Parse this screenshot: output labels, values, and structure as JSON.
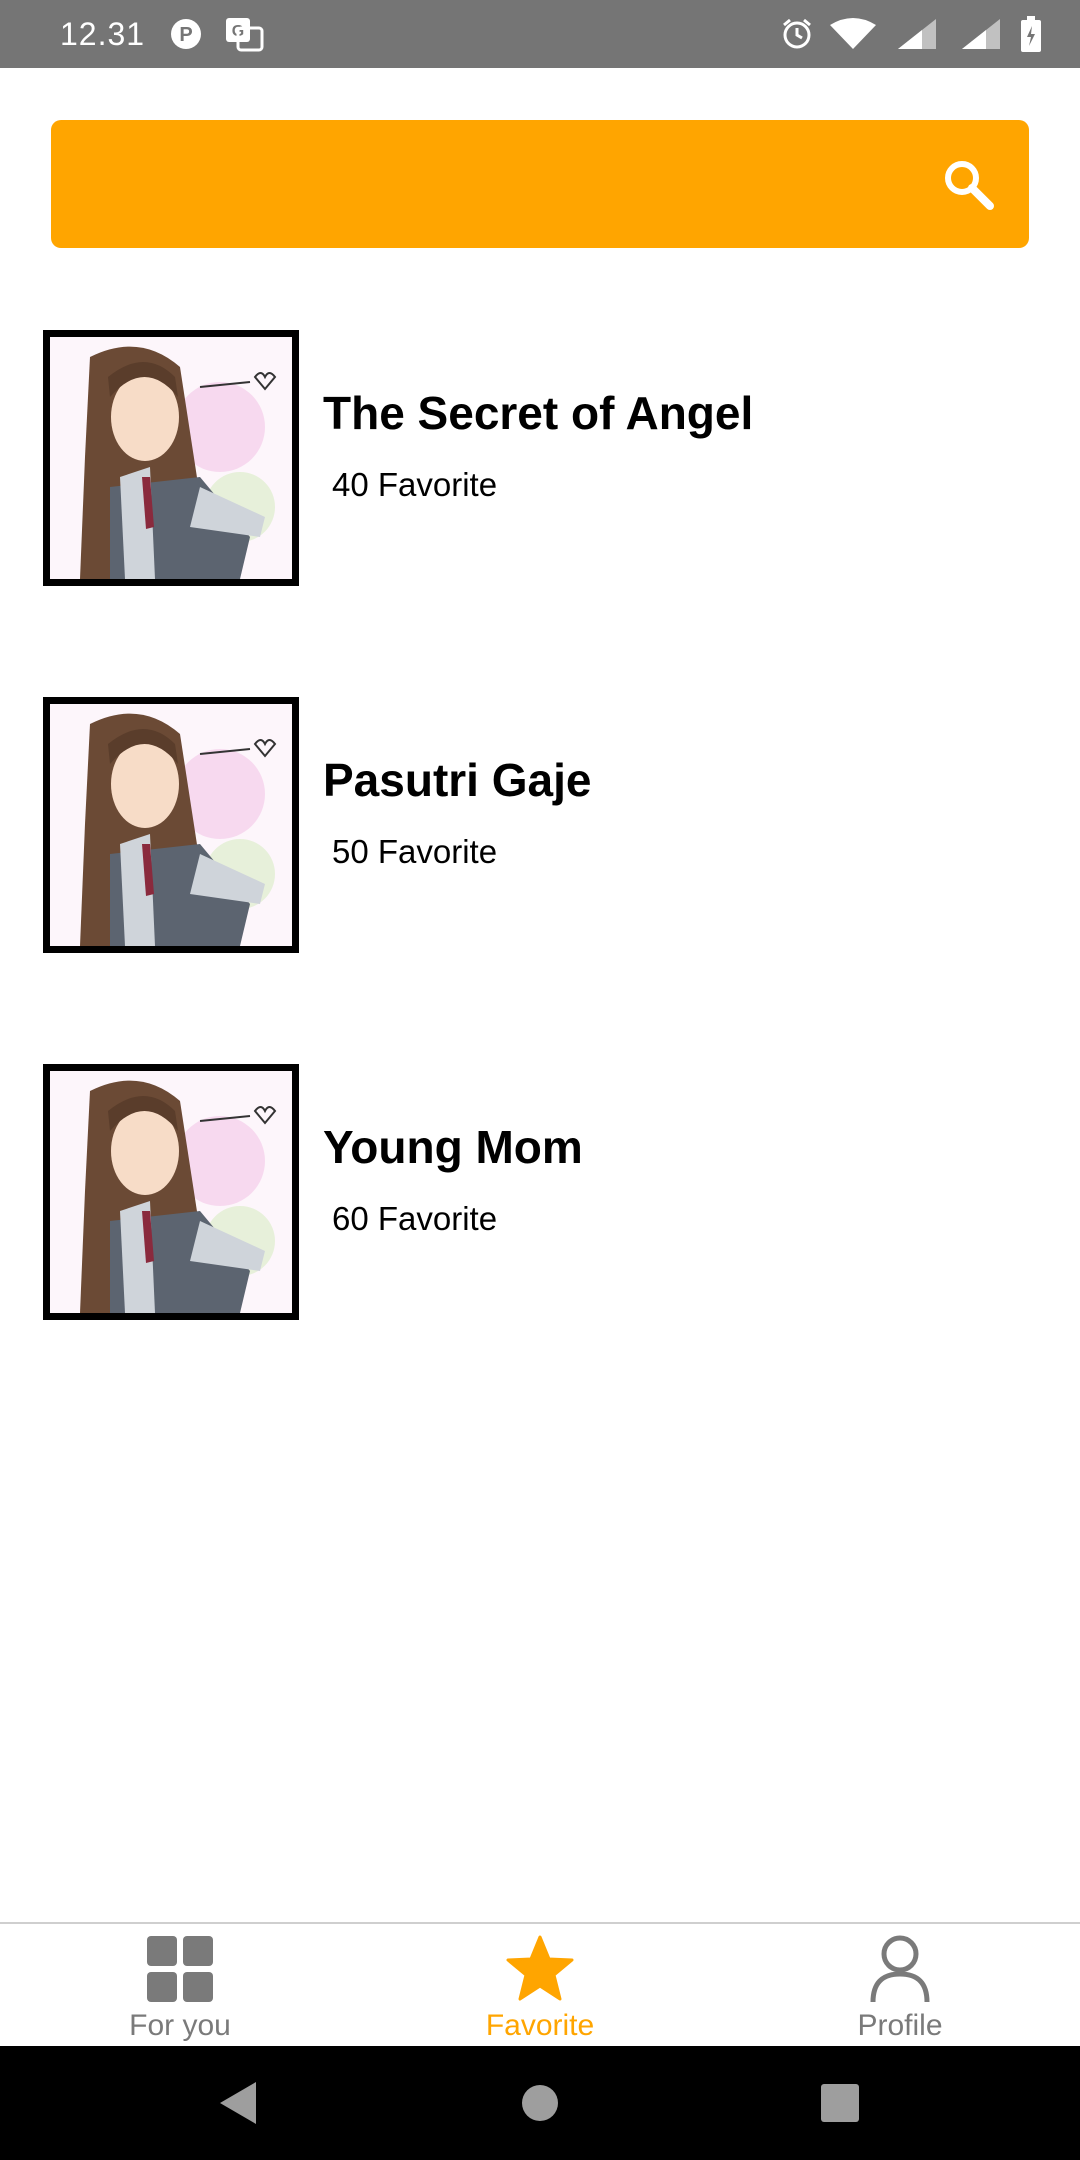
{
  "status_bar": {
    "time": "12.31",
    "left_icons": [
      "p-app-icon",
      "translate-icon"
    ],
    "right_icons": [
      "alarm-icon",
      "wifi-icon",
      "signal-icon",
      "signal-icon",
      "battery-icon"
    ]
  },
  "search": {
    "icon": "search-icon",
    "background_color": "#ffa500"
  },
  "comics": [
    {
      "title": "The Secret of Angel",
      "favorites": " 40 Favorite"
    },
    {
      "title": "Pasutri Gaje",
      "favorites": " 50 Favorite"
    },
    {
      "title": "Young Mom",
      "favorites": " 60 Favorite"
    }
  ],
  "bottom_nav": {
    "items": [
      {
        "label": "For you",
        "icon": "grid-icon",
        "active": false
      },
      {
        "label": "Favorite",
        "icon": "star-icon",
        "active": true
      },
      {
        "label": "Profile",
        "icon": "person-icon",
        "active": false
      }
    ],
    "active_color": "#ffa500",
    "inactive_color": "#7a7a7a"
  },
  "system_nav": [
    "back-icon",
    "home-icon",
    "recents-icon"
  ]
}
